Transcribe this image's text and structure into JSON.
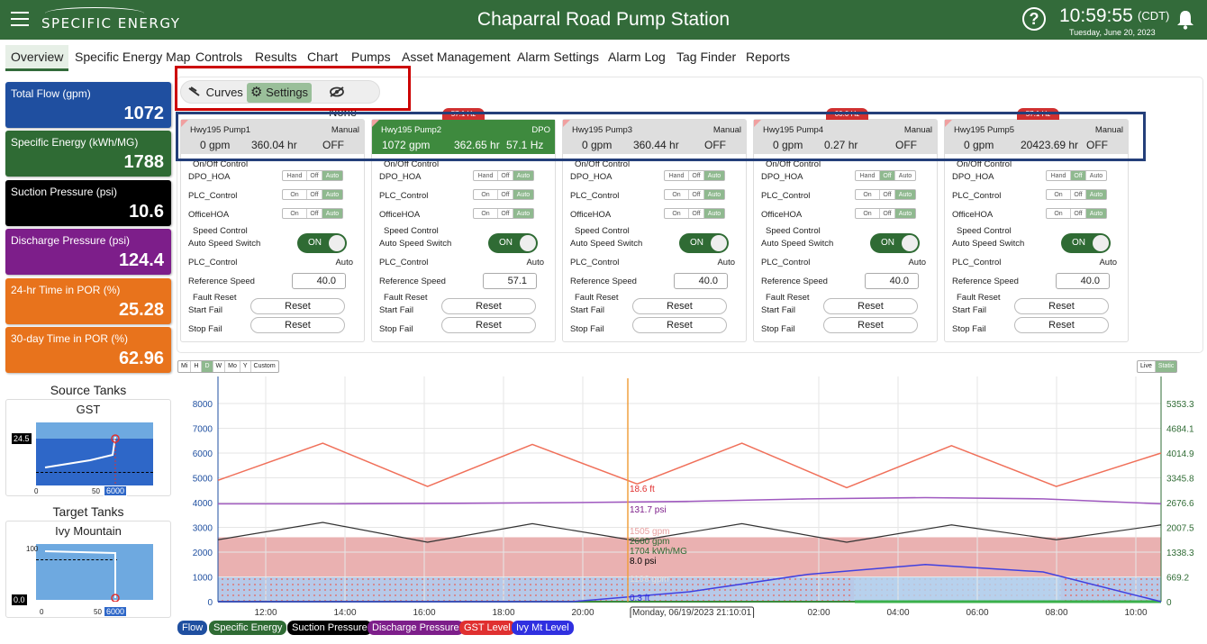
{
  "header": {
    "brand": "SPECIFIC ENERGY",
    "title": "Chaparral Road Pump Station",
    "time": "10:59:55",
    "tz": "(CDT)",
    "date": "Tuesday, June 20, 2023",
    "help": "?"
  },
  "nav": [
    "Overview",
    "Specific Energy Map",
    "Controls",
    "Results",
    "Chart",
    "Pumps",
    "Asset Management",
    "Alarm Settings",
    "Alarm Log",
    "Tag Finder",
    "Reports"
  ],
  "kpis": [
    {
      "label": "Total Flow (gpm)",
      "value": "1072",
      "color": "#1f4fa0"
    },
    {
      "label": "Specific Energy (kWh/MG)",
      "value": "1788",
      "color": "#2f6b34"
    },
    {
      "label": "Suction Pressure (psi)",
      "value": "10.6",
      "color": "#000000"
    },
    {
      "label": "Discharge Pressure (psi)",
      "value": "124.4",
      "color": "#7d1e8a"
    },
    {
      "label": "24-hr Time in POR (%)",
      "value": "25.28",
      "color": "#e8731c"
    },
    {
      "label": "30-day Time in POR (%)",
      "value": "62.96",
      "color": "#e8731c"
    }
  ],
  "tanks": {
    "source_title": "Source Tanks",
    "source_name": "GST",
    "source_level": "24.5",
    "source_flow": "6000",
    "target_title": "Target Tanks",
    "target_name": "Ivy Mountain",
    "target_level": "0.0",
    "target_flow": "6000",
    "x0": "0",
    "x50": "50",
    "y100": "100"
  },
  "view_toggle": {
    "curves": "Curves",
    "settings": "Settings",
    "none": "None"
  },
  "pumps": [
    {
      "name": "Hwy195 Pump1",
      "mode": "Manual",
      "flow": "0 gpm",
      "hours": "360.04 hr",
      "state": "OFF",
      "running": false,
      "badge": "",
      "ref": "40.0",
      "dpo": "Auto",
      "plc": "Auto",
      "office": "Auto"
    },
    {
      "name": "Hwy195 Pump2",
      "mode": "DPO",
      "flow": "1072 gpm",
      "hours": "362.65 hr",
      "state": "57.1 Hz",
      "running": true,
      "badge": "57.1 Hz",
      "ref": "57.1",
      "dpo": "Auto",
      "plc": "Auto",
      "office": "Auto"
    },
    {
      "name": "Hwy195 Pump3",
      "mode": "Manual",
      "flow": "0 gpm",
      "hours": "360.44 hr",
      "state": "OFF",
      "running": false,
      "badge": "",
      "ref": "40.0",
      "dpo": "Auto",
      "plc": "Auto",
      "office": "Auto"
    },
    {
      "name": "Hwy195 Pump4",
      "mode": "Manual",
      "flow": "0 gpm",
      "hours": "0.27 hr",
      "state": "OFF",
      "running": false,
      "badge": "00.0 Hz",
      "ref": "40.0",
      "dpo": "Off",
      "plc": "Auto",
      "office": "Auto"
    },
    {
      "name": "Hwy195 Pump5",
      "mode": "Manual",
      "flow": "0 gpm",
      "hours": "20423.69 hr",
      "state": "OFF",
      "running": false,
      "badge": "57.1 Hz",
      "ref": "40.0",
      "dpo": "Off",
      "plc": "Auto",
      "office": "Auto"
    }
  ],
  "pump_labels": {
    "onoff": "On/Off Control",
    "dpo": "DPO_HOA",
    "plc": "PLC_Control",
    "office": "OfficeHOA",
    "speed": "Speed Control",
    "auto_switch": "Auto Speed Switch",
    "sw_on": "ON",
    "plc_speed": "PLC_Control",
    "plc_speed_val": "Auto",
    "refspeed": "Reference Speed",
    "fault": "Fault Reset",
    "start": "Start Fail",
    "stop": "Stop Fail",
    "reset": "Reset",
    "hand": "Hand",
    "off": "Off",
    "auto": "Auto",
    "on": "On"
  },
  "ranges": [
    "Mi",
    "H",
    "D",
    "W",
    "Mo",
    "Y",
    "Custom"
  ],
  "live_static": [
    "Live",
    "Static"
  ],
  "chart_data": {
    "type": "line",
    "x_ticks": [
      "12:00",
      "14:00",
      "16:00",
      "18:00",
      "20:00",
      "Monday, 06/19/2023 21:10:01",
      "02:00",
      "04:00",
      "06:00",
      "08:00",
      "10:00"
    ],
    "y_left": {
      "range": [
        0,
        8000
      ],
      "ticks": [
        "0",
        "1000",
        "2000",
        "3000",
        "4000",
        "5000",
        "6000",
        "7000",
        "8000"
      ]
    },
    "y_right": {
      "ticks": [
        "0",
        "669.2",
        "1338.3",
        "2007.5",
        "2676.6",
        "3345.8",
        "4014.9",
        "4684.1",
        "5353.3"
      ]
    },
    "cursor_readout": [
      "18.6 ft",
      "131.7 psi",
      "1505 gpm",
      "2660 gpm",
      "1704 kWh/MG",
      "8.0 psi",
      "1106 gpm",
      "0.3 ft"
    ],
    "series": [
      {
        "name": "Flow",
        "color": "#1f4fa0"
      },
      {
        "name": "Specific Energy",
        "color": "#2f6b34"
      },
      {
        "name": "Suction Pressure",
        "color": "#000000"
      },
      {
        "name": "Discharge Pressure",
        "color": "#7d1e8a"
      },
      {
        "name": "GST Level",
        "color": "#e03030"
      },
      {
        "name": "Ivy Mt Level",
        "color": "#3030e0"
      }
    ],
    "gst_level_left": [
      4900,
      6400,
      4650,
      6350,
      4750,
      6400,
      4600,
      6300,
      4650,
      6000
    ],
    "discharge_left": [
      3950,
      3950,
      3970,
      4000,
      4050,
      4150,
      4200,
      4150,
      3950
    ],
    "suction_left": [
      2500,
      3200,
      2400,
      3150,
      2450,
      3150,
      2400,
      3100,
      2500,
      3100
    ],
    "ivy_left": [
      0,
      0,
      0,
      0,
      400,
      1100,
      1500,
      1200,
      0
    ]
  }
}
